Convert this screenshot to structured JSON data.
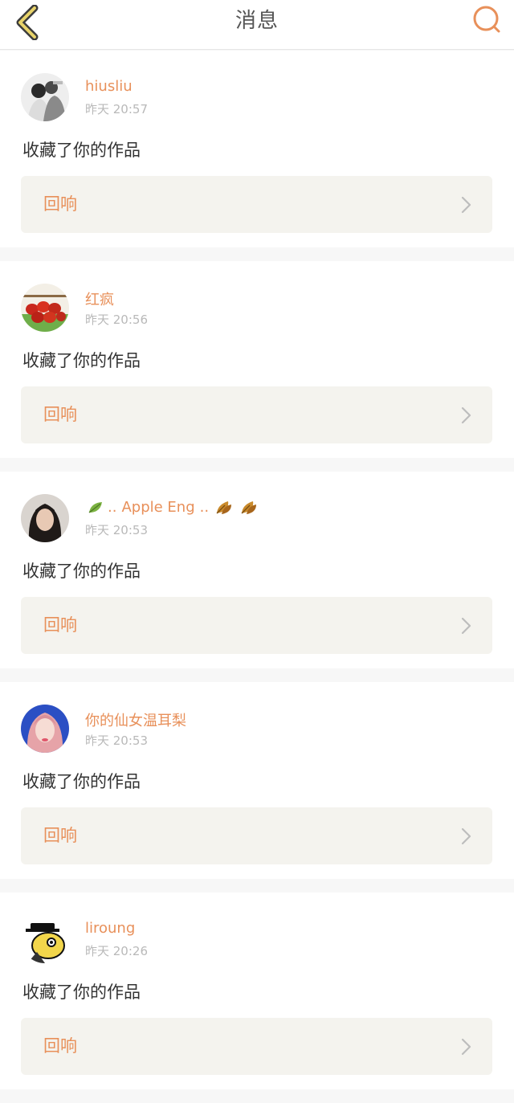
{
  "header": {
    "title": "消息",
    "back_icon": "chevron-left-icon",
    "search_icon": "search-icon",
    "accent_color": "#e8905a",
    "back_color": "#c9a227"
  },
  "messages": [
    {
      "username": "hiusliu",
      "timestamp": "昨天 20:57",
      "action": "收藏了你的作品",
      "reply_label": "回响",
      "avatar_icon": "couple-photo-avatar"
    },
    {
      "username": "红疯",
      "timestamp": "昨天 20:56",
      "action": "收藏了你的作品",
      "reply_label": "回响",
      "avatar_icon": "food-photo-avatar"
    },
    {
      "username_prefix": "..",
      "username": "Apple Eng",
      "username_suffix": "..",
      "timestamp": "昨天 20:53",
      "action": "收藏了你的作品",
      "reply_label": "回响",
      "avatar_icon": "portrait-photo-avatar",
      "decor_icons": [
        "leaf-icon",
        "autumn-leaf-icon",
        "autumn-leaf-icon"
      ]
    },
    {
      "username": "你的仙女温耳梨",
      "timestamp": "昨天 20:53",
      "action": "收藏了你的作品",
      "reply_label": "回响",
      "avatar_icon": "selfie-photo-avatar"
    },
    {
      "username": "liroung",
      "timestamp": "昨天 20:26",
      "action": "收藏了你的作品",
      "reply_label": "回响",
      "avatar_icon": "cartoon-detective-avatar"
    }
  ]
}
